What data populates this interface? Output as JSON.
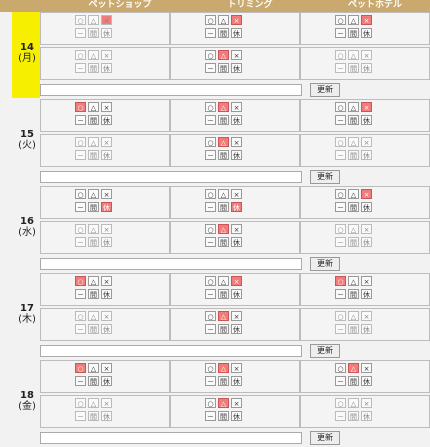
{
  "columns": [
    "ペットショップ",
    "トリミング",
    "ペットホテル"
  ],
  "update_label": "更新",
  "button_symbols": {
    "open": "○",
    "few": "△",
    "full": "×",
    "dash": "－",
    "time": "間",
    "closed": "休"
  },
  "days": [
    {
      "date": "14",
      "weekday": "(月)",
      "highlight": true,
      "rows": [
        [
          {
            "on": [
              "full"
            ],
            "dim": true
          },
          {
            "on": [
              "full"
            ]
          },
          {
            "on": [
              "full"
            ]
          }
        ],
        [
          {
            "on": [],
            "dim": true
          },
          {
            "on": [
              "few"
            ]
          },
          {
            "on": [],
            "dim": true
          }
        ]
      ]
    },
    {
      "date": "15",
      "weekday": "(火)",
      "highlight": false,
      "rows": [
        [
          {
            "on": [
              "open"
            ]
          },
          {
            "on": [
              "few"
            ]
          },
          {
            "on": [
              "full"
            ]
          }
        ],
        [
          {
            "on": [],
            "dim": true
          },
          {
            "on": [
              "few"
            ]
          },
          {
            "on": [],
            "dim": true
          }
        ]
      ]
    },
    {
      "date": "16",
      "weekday": "(水)",
      "highlight": false,
      "rows": [
        [
          {
            "on": [
              "closed"
            ]
          },
          {
            "on": [
              "closed"
            ]
          },
          {
            "on": [
              "full"
            ]
          }
        ],
        [
          {
            "on": [],
            "dim": true
          },
          {
            "on": [
              "few"
            ]
          },
          {
            "on": [],
            "dim": true
          }
        ]
      ]
    },
    {
      "date": "17",
      "weekday": "(木)",
      "highlight": false,
      "rows": [
        [
          {
            "on": [
              "open"
            ]
          },
          {
            "on": [
              "full"
            ]
          },
          {
            "on": [
              "open"
            ]
          }
        ],
        [
          {
            "on": [],
            "dim": true
          },
          {
            "on": [
              "few"
            ]
          },
          {
            "on": [],
            "dim": true
          }
        ]
      ]
    },
    {
      "date": "18",
      "weekday": "(金)",
      "highlight": false,
      "rows": [
        [
          {
            "on": [
              "open"
            ]
          },
          {
            "on": [
              "few"
            ]
          },
          {
            "on": [
              "few"
            ]
          }
        ],
        [
          {
            "on": [],
            "dim": true
          },
          {
            "on": [
              "few"
            ]
          },
          {
            "on": [],
            "dim": true
          }
        ]
      ]
    }
  ]
}
